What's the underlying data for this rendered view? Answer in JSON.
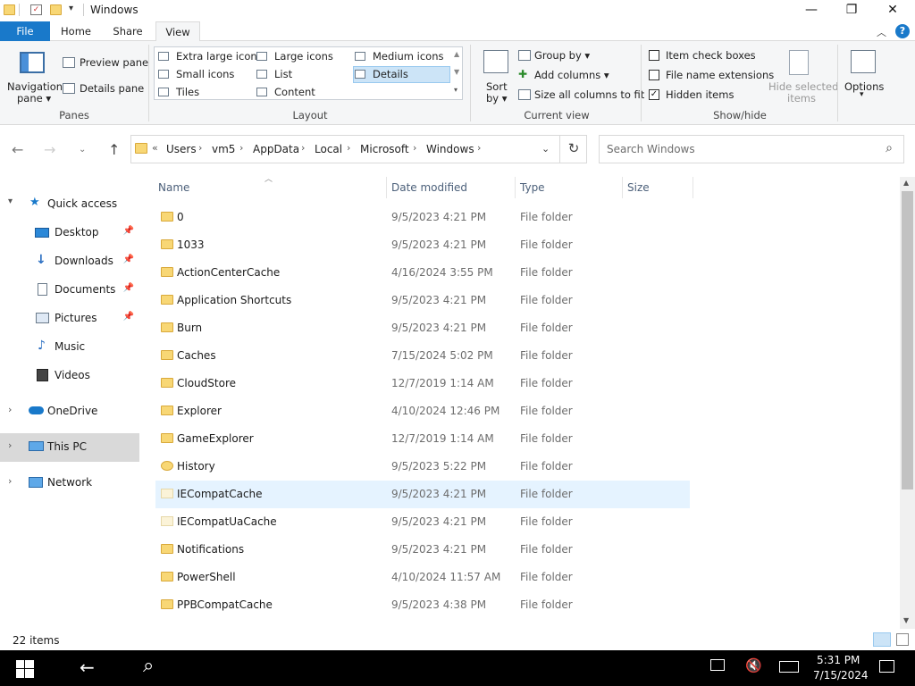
{
  "window": {
    "title": "Windows",
    "minimize": "—",
    "restore": "❐",
    "close": "✕"
  },
  "ribbon_tabs": [
    "File",
    "Home",
    "Share",
    "View"
  ],
  "ribbon": {
    "panes": {
      "navigation_pane": "Navigation",
      "navigation_pane_2": "pane ▾",
      "preview_pane": "Preview pane",
      "details_pane": "Details pane",
      "group_label": "Panes"
    },
    "layout": {
      "options": [
        "Extra large icons",
        "Large icons",
        "Medium icons",
        "Small icons",
        "List",
        "Details",
        "Tiles",
        "Content"
      ],
      "selected": "Details",
      "group_label": "Layout"
    },
    "current_view": {
      "sort_by": "Sort",
      "sort_by_2": "by ▾",
      "group_by": "Group by ▾",
      "add_columns": "Add columns ▾",
      "size_all_columns": "Size all columns to fit",
      "group_label": "Current view"
    },
    "show_hide": {
      "item_check_boxes": "Item check boxes",
      "file_name_extensions": "File name extensions",
      "hidden_items": "Hidden items",
      "hidden_items_checked": true,
      "hide_selected": "Hide selected",
      "hide_selected_2": "items",
      "group_label": "Show/hide"
    },
    "options": {
      "label": "Options",
      "arrow": "▾"
    }
  },
  "address": {
    "breadcrumbs": [
      "Users",
      "vm5",
      "AppData",
      "Local",
      "Microsoft",
      "Windows"
    ],
    "overflow": "«",
    "search_placeholder": "Search Windows"
  },
  "nav": {
    "quick_access": "Quick access",
    "quick_items": [
      "Desktop",
      "Downloads",
      "Documents",
      "Pictures",
      "Music",
      "Videos"
    ],
    "onedrive": "OneDrive",
    "this_pc": "This PC",
    "network": "Network"
  },
  "columns": {
    "name": "Name",
    "date_modified": "Date modified",
    "type": "Type",
    "size": "Size"
  },
  "files": [
    {
      "name": "0",
      "date": "9/5/2023 4:21 PM",
      "type": "File folder",
      "icon": "folder-icon"
    },
    {
      "name": "1033",
      "date": "9/5/2023 4:21 PM",
      "type": "File folder",
      "icon": "folder-icon"
    },
    {
      "name": "ActionCenterCache",
      "date": "4/16/2024 3:55 PM",
      "type": "File folder",
      "icon": "folder-icon"
    },
    {
      "name": "Application Shortcuts",
      "date": "9/5/2023 4:21 PM",
      "type": "File folder",
      "icon": "folder-icon"
    },
    {
      "name": "Burn",
      "date": "9/5/2023 4:21 PM",
      "type": "File folder",
      "icon": "folder-icon"
    },
    {
      "name": "Caches",
      "date": "7/15/2024 5:02 PM",
      "type": "File folder",
      "icon": "folder-icon"
    },
    {
      "name": "CloudStore",
      "date": "12/7/2019 1:14 AM",
      "type": "File folder",
      "icon": "folder-icon"
    },
    {
      "name": "Explorer",
      "date": "4/10/2024 12:46 PM",
      "type": "File folder",
      "icon": "folder-icon"
    },
    {
      "name": "GameExplorer",
      "date": "12/7/2019 1:14 AM",
      "type": "File folder",
      "icon": "folder-icon"
    },
    {
      "name": "History",
      "date": "9/5/2023 5:22 PM",
      "type": "File folder",
      "icon": "history-folder-icon"
    },
    {
      "name": "IECompatCache",
      "date": "9/5/2023 4:21 PM",
      "type": "File folder",
      "icon": "hidden-folder-icon",
      "hover": true
    },
    {
      "name": "IECompatUaCache",
      "date": "9/5/2023 4:21 PM",
      "type": "File folder",
      "icon": "hidden-folder-icon"
    },
    {
      "name": "Notifications",
      "date": "9/5/2023 4:21 PM",
      "type": "File folder",
      "icon": "folder-icon"
    },
    {
      "name": "PowerShell",
      "date": "4/10/2024 11:57 AM",
      "type": "File folder",
      "icon": "folder-icon"
    },
    {
      "name": "PPBCompatCache",
      "date": "9/5/2023 4:38 PM",
      "type": "File folder",
      "icon": "folder-icon"
    }
  ],
  "status": {
    "item_count": "22 items"
  },
  "taskbar": {
    "time": "5:31 PM",
    "date": "7/15/2024"
  },
  "colors": {
    "accent": "#1979ca",
    "folder": "#f8d775",
    "hover_row": "#e5f3ff",
    "selected_layout": "#cce4f7"
  }
}
